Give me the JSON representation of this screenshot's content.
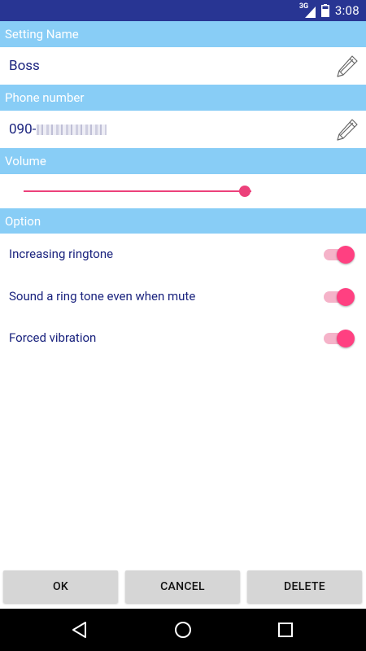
{
  "statusbar": {
    "network": "3G",
    "time": "3:08"
  },
  "setting_name": {
    "header": "Setting Name",
    "value": "Boss"
  },
  "phone": {
    "header": "Phone number",
    "value_prefix": "090-"
  },
  "volume": {
    "header": "Volume",
    "level_percent": 96
  },
  "option": {
    "header": "Option",
    "items": [
      {
        "label": "Increasing ringtone",
        "enabled": true
      },
      {
        "label": "Sound a ring tone even when mute",
        "enabled": true
      },
      {
        "label": "Forced vibration",
        "enabled": true
      }
    ]
  },
  "buttons": {
    "ok": "OK",
    "cancel": "CANCEL",
    "delete": "DELETE"
  },
  "colors": {
    "statusbar": "#283593",
    "section_header": "#88cdf6",
    "accent": "#ff4081",
    "text": "#1a237e"
  }
}
